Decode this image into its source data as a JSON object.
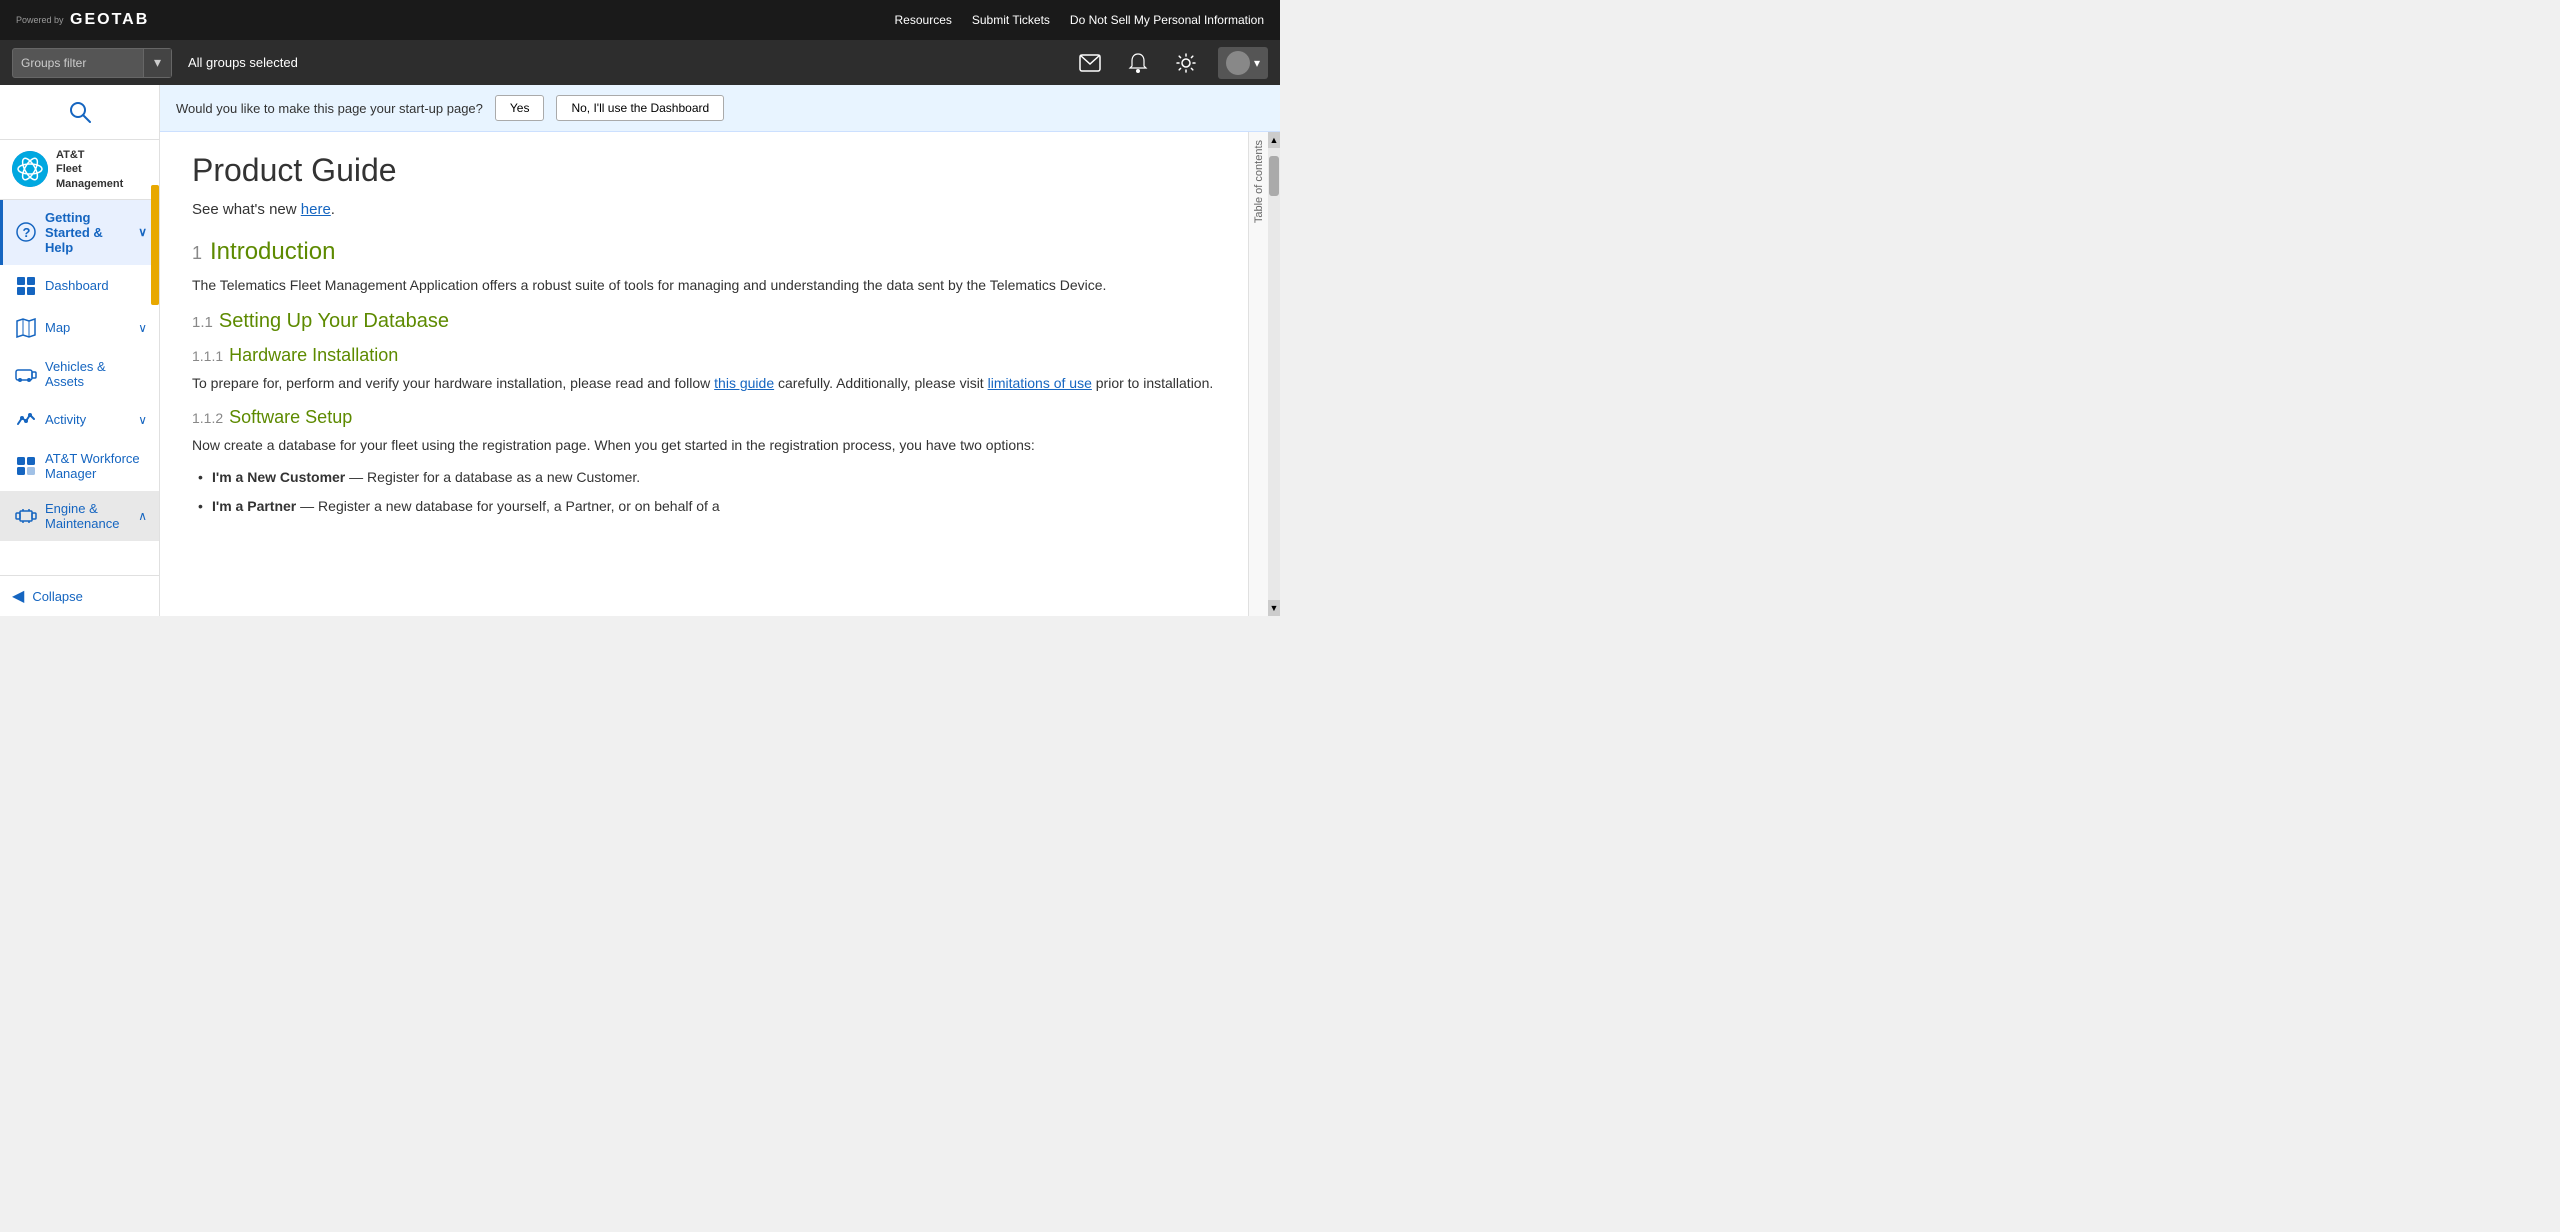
{
  "topbar": {
    "powered_by": "Powered by",
    "logo_text": "GEOTAB",
    "links": {
      "resources": "Resources",
      "submit_tickets": "Submit Tickets",
      "do_not_sell": "Do Not Sell My Personal Information"
    }
  },
  "filterbar": {
    "groups_filter_label": "Groups filter",
    "all_groups": "All groups selected",
    "dropdown_arrow": "▾"
  },
  "sidebar": {
    "brand_name": "AT&T\nFleet Management",
    "brand_initials": "AT&T",
    "search_placeholder": "Search",
    "nav_items": [
      {
        "id": "getting-started",
        "label": "Getting Started & Help",
        "icon": "❓",
        "active": true,
        "expandable": true,
        "expanded": true
      },
      {
        "id": "dashboard",
        "label": "Dashboard",
        "icon": "📊",
        "active": false,
        "expandable": false
      },
      {
        "id": "map",
        "label": "Map",
        "icon": "🗺",
        "active": false,
        "expandable": true
      },
      {
        "id": "vehicles-assets",
        "label": "Vehicles & Assets",
        "icon": "🚚",
        "active": false,
        "expandable": false
      },
      {
        "id": "activity",
        "label": "Activity",
        "icon": "📈",
        "active": false,
        "expandable": true
      },
      {
        "id": "att-workforce",
        "label": "AT&T Workforce Manager",
        "icon": "🧩",
        "active": false,
        "expandable": false
      },
      {
        "id": "engine-maintenance",
        "label": "Engine & Maintenance",
        "icon": "🔧",
        "active": false,
        "expandable": true,
        "highlighted": true
      }
    ],
    "collapse_label": "Collapse"
  },
  "startup_bar": {
    "question": "Would you like to make this page your start-up page?",
    "yes_label": "Yes",
    "no_label": "No, I'll use the Dashboard"
  },
  "document": {
    "title": "Product Guide",
    "intro_text": "See what's new ",
    "intro_link": "here",
    "intro_period": ".",
    "section1": {
      "num": "1",
      "title": "Introduction",
      "body": "The Telematics Fleet Management Application offers a robust suite of tools for managing and understanding the data sent by the Telematics Device."
    },
    "section1_1": {
      "num": "1.1",
      "title": "Setting Up Your Database"
    },
    "section1_1_1": {
      "num": "1.1.1",
      "title": "Hardware Installation",
      "body_before": "To prepare for, perform and verify your hardware installation, please read and follow ",
      "link1": "this guide",
      "body_middle": " carefully. Additionally, please visit ",
      "link2": "limitations of use",
      "body_after": " prior to installation."
    },
    "section1_1_2": {
      "num": "1.1.2",
      "title": "Software Setup",
      "body": "Now create a database for your fleet using the registration page. When you get started in the registration process, you have two options:"
    },
    "list_items": [
      {
        "bold": "I'm a New Customer",
        "text": " — Register for a database as a new Customer."
      },
      {
        "bold": "I'm a Partner",
        "text": " — Register a new database for yourself, a Partner, or on behalf of a"
      }
    ]
  },
  "toc": {
    "label": "Table of contents"
  }
}
